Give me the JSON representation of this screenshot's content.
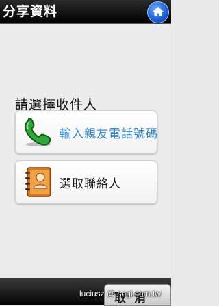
{
  "header": {
    "title": "分享資料",
    "home_icon": "home-icon"
  },
  "main": {
    "prompt": "請選擇收件人",
    "options": [
      {
        "label": "輸入親友電話號碼",
        "icon": "phone-icon",
        "color": "#2f8bd0"
      },
      {
        "label": "選取聯絡人",
        "icon": "contacts-book-icon",
        "color": "#111111"
      }
    ]
  },
  "footer": {
    "cancel_label": "取消"
  },
  "watermark": {
    "text": "luciusz  @ sogi.com.tw"
  }
}
